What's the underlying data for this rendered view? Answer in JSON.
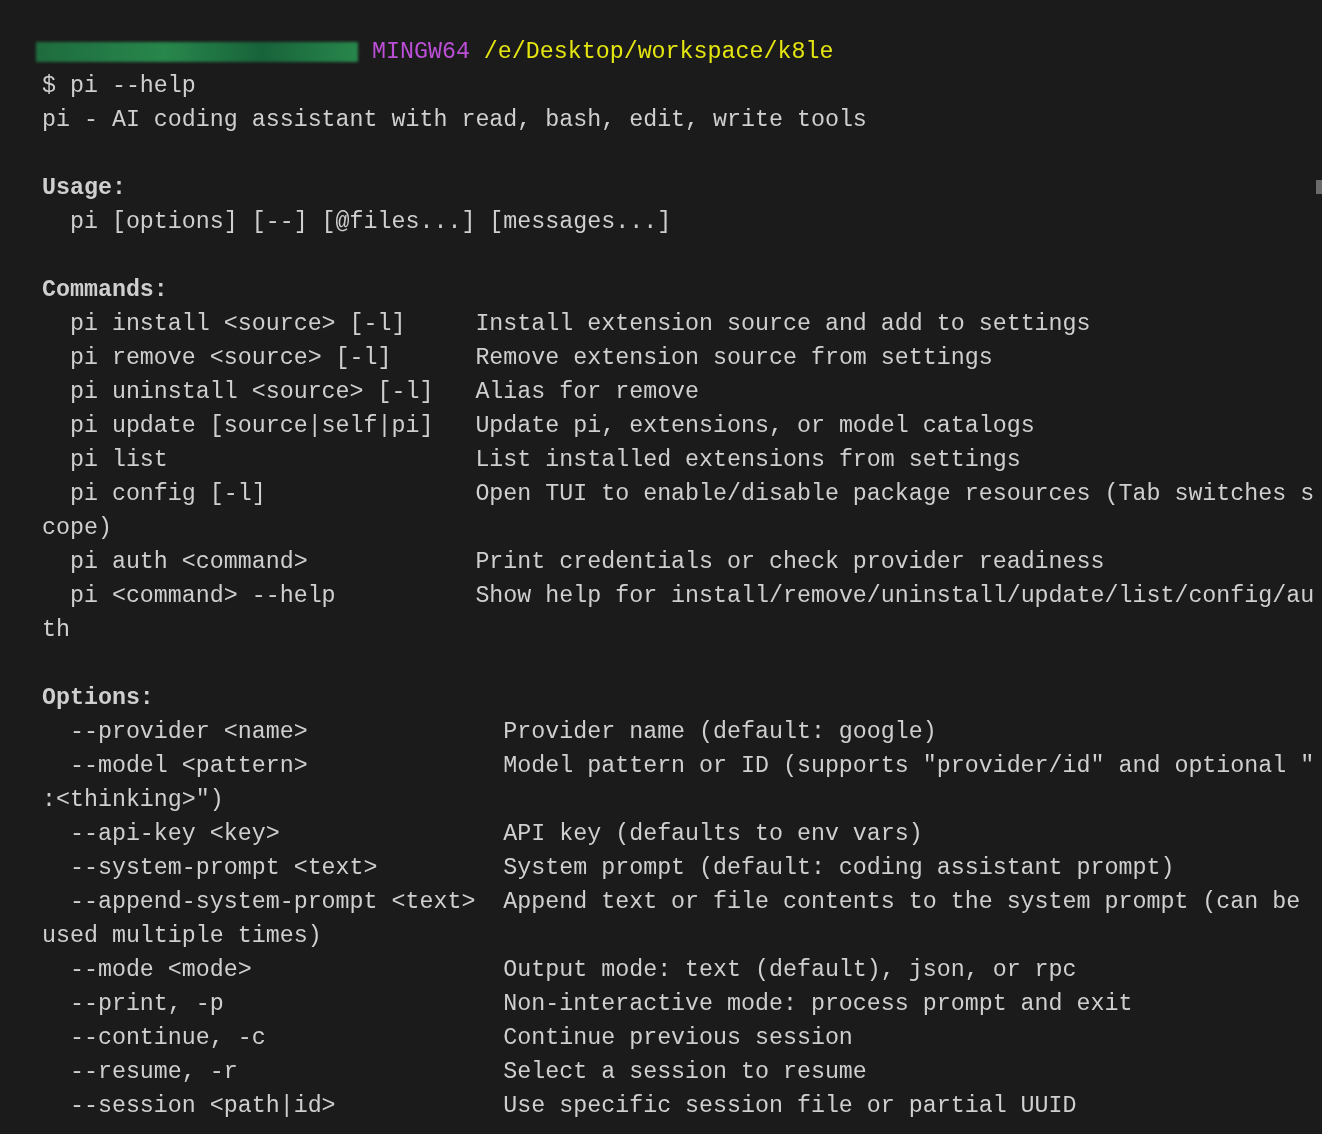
{
  "terminal": {
    "lines": [
      {
        "kind": "prompt",
        "shell": "MINGW64",
        "path": "/e/Desktop/workspace/k8le"
      },
      {
        "kind": "text",
        "text": "$ pi --help"
      },
      {
        "kind": "text",
        "text": "pi - AI coding assistant with read, bash, edit, write tools"
      },
      {
        "kind": "blank"
      },
      {
        "kind": "heading",
        "text": "Usage:"
      },
      {
        "kind": "text",
        "text": "  pi [options] [--] [@files...] [messages...]"
      },
      {
        "kind": "blank"
      },
      {
        "kind": "heading",
        "text": "Commands:"
      },
      {
        "kind": "command",
        "left": "  pi install <source> [-l]",
        "right": "Install extension source and add to settings"
      },
      {
        "kind": "command",
        "left": "  pi remove <source> [-l]",
        "right": "Remove extension source from settings"
      },
      {
        "kind": "command",
        "left": "  pi uninstall <source> [-l]",
        "right": "Alias for remove"
      },
      {
        "kind": "command",
        "left": "  pi update [source|self|pi]",
        "right": "Update pi, extensions, or model catalogs"
      },
      {
        "kind": "command",
        "left": "  pi list",
        "right": "List installed extensions from settings"
      },
      {
        "kind": "command",
        "left": "  pi config [-l]",
        "right": "Open TUI to enable/disable package resources (Tab switches s"
      },
      {
        "kind": "text",
        "text": "cope)"
      },
      {
        "kind": "command",
        "left": "  pi auth <command>",
        "right": "Print credentials or check provider readiness"
      },
      {
        "kind": "command",
        "left": "  pi <command> --help",
        "right": "Show help for install/remove/uninstall/update/list/config/au"
      },
      {
        "kind": "text",
        "text": "th"
      },
      {
        "kind": "blank"
      },
      {
        "kind": "heading",
        "text": "Options:"
      },
      {
        "kind": "option",
        "left": "  --provider <name>",
        "right": "Provider name (default: google)"
      },
      {
        "kind": "option",
        "left": "  --model <pattern>",
        "right": "Model pattern or ID (supports \"provider/id\" and optional \""
      },
      {
        "kind": "text",
        "text": ":<thinking>\")"
      },
      {
        "kind": "option",
        "left": "  --api-key <key>",
        "right": "API key (defaults to env vars)"
      },
      {
        "kind": "option",
        "left": "  --system-prompt <text>",
        "right": "System prompt (default: coding assistant prompt)"
      },
      {
        "kind": "option",
        "left": "  --append-system-prompt <text>",
        "right": "Append text or file contents to the system prompt (can be"
      },
      {
        "kind": "text",
        "text": "used multiple times)"
      },
      {
        "kind": "option",
        "left": "  --mode <mode>",
        "right": "Output mode: text (default), json, or rpc"
      },
      {
        "kind": "option",
        "left": "  --print, -p",
        "right": "Non-interactive mode: process prompt and exit"
      },
      {
        "kind": "option",
        "left": "  --continue, -c",
        "right": "Continue previous session"
      },
      {
        "kind": "option",
        "left": "  --resume, -r",
        "right": "Select a session to resume"
      },
      {
        "kind": "option",
        "left": "  --session <path|id>",
        "right": "Use specific session file or partial UUID"
      }
    ]
  }
}
